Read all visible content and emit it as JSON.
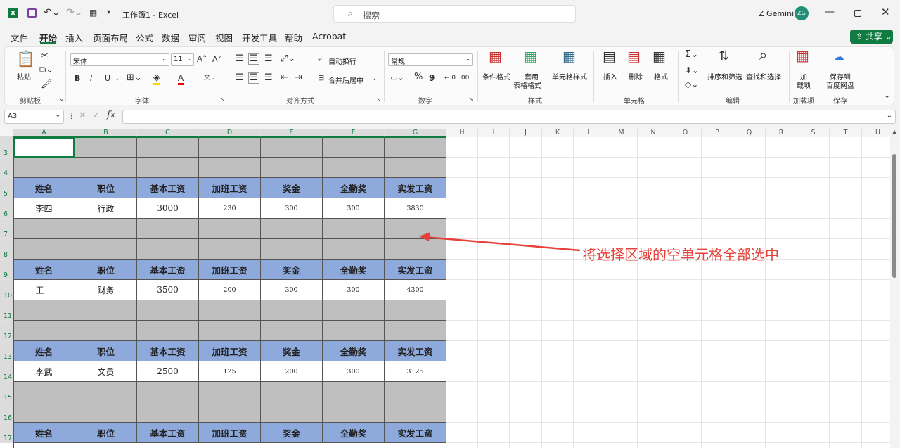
{
  "titlebar": {
    "doc_title": "工作簿1 - Excel",
    "search_placeholder": "搜索",
    "user_name": "Z Gemini",
    "user_initials": "ZG",
    "excel_logo": "x"
  },
  "menu": {
    "items": [
      "文件",
      "开始",
      "插入",
      "页面布局",
      "公式",
      "数据",
      "审阅",
      "视图",
      "开发工具",
      "帮助",
      "Acrobat"
    ],
    "share_label": "共享"
  },
  "ribbon": {
    "clipboard": {
      "paste": "粘贴",
      "group": "剪贴板"
    },
    "font": {
      "name": "宋体",
      "size": "11",
      "bold": "B",
      "italic": "I",
      "underline": "U",
      "grow": "A",
      "shrink": "A",
      "color_a": "A",
      "group": "字体"
    },
    "alignment": {
      "wrap": "自动换行",
      "merge": "合并后居中",
      "group": "对齐方式"
    },
    "number": {
      "format": "常规",
      "percent": "%",
      "comma": "9",
      "group": "数字"
    },
    "styles": {
      "cond": "条件格式",
      "table1": "套用",
      "table2": "表格格式",
      "cell_style": "单元格样式",
      "group": "样式"
    },
    "cells": {
      "insert": "插入",
      "delete": "删除",
      "format": "格式",
      "group": "单元格"
    },
    "editing": {
      "sort": "排序和筛选",
      "find": "查找和选择",
      "group": "编辑",
      "sum": "Σ"
    },
    "addins": {
      "label1": "加",
      "label2": "载项",
      "group": "加载项"
    },
    "save": {
      "label1": "保存到",
      "label2": "百度网盘",
      "group": "保存"
    }
  },
  "formula_bar": {
    "name_box": "A3",
    "fx": "fx",
    "value": ""
  },
  "sheet": {
    "columns": [
      "A",
      "B",
      "C",
      "D",
      "E",
      "F",
      "G",
      "H",
      "I",
      "J",
      "K",
      "L",
      "M",
      "N",
      "O",
      "P",
      "Q",
      "R",
      "S",
      "T",
      "U"
    ],
    "rows": [
      "3",
      "4",
      "5",
      "6",
      "7",
      "8",
      "9",
      "10",
      "11",
      "12",
      "13",
      "14",
      "15",
      "16",
      "17"
    ],
    "header": [
      "姓名",
      "职位",
      "基本工资",
      "加班工资",
      "奖金",
      "全勤奖",
      "实发工资"
    ],
    "records": [
      [
        "李四",
        "行政",
        "3000",
        "230",
        "300",
        "300",
        "3830"
      ],
      [
        "王一",
        "财务",
        "3500",
        "200",
        "300",
        "300",
        "4300"
      ],
      [
        "李武",
        "文员",
        "2500",
        "125",
        "200",
        "300",
        "3125"
      ]
    ]
  },
  "annotation": {
    "text": "将选择区域的空单元格全部选中",
    "color": "#e8403a"
  },
  "colors": {
    "header_fill": "#8ea9db",
    "empty_fill": "#bfbfbf",
    "excel_green": "#107c41"
  }
}
